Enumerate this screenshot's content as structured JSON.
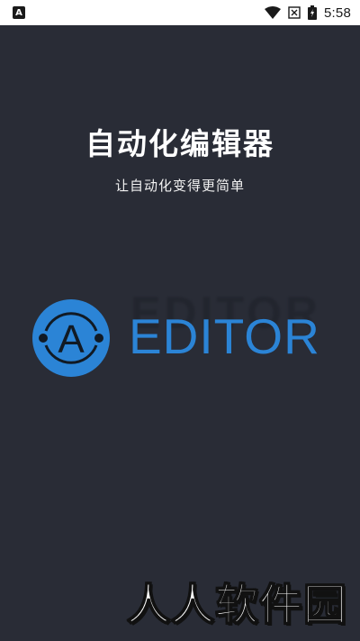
{
  "status_bar": {
    "notification_icon": "app-a-icon",
    "icons": [
      "wifi-icon",
      "signal-off-icon",
      "battery-charging-icon"
    ],
    "time": "5:58"
  },
  "splash": {
    "title": "自动化编辑器",
    "subtitle": "让自动化变得更简单",
    "logo": {
      "emblem_letter": "A",
      "wordmark": "EDITOR",
      "color": "#2b84d6"
    },
    "background_color": "#292c36"
  },
  "watermark": "人人软件园"
}
